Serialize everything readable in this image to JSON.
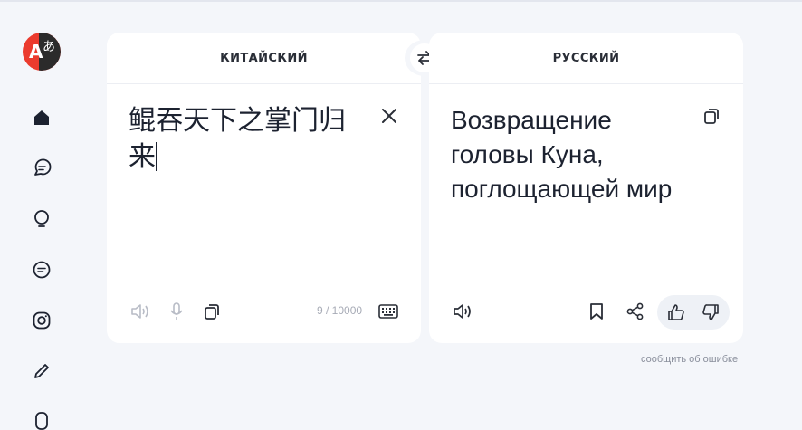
{
  "sidebar": {
    "items": [
      {
        "icon": "home-icon"
      },
      {
        "icon": "chat-icon"
      },
      {
        "icon": "lightbulb-icon"
      },
      {
        "icon": "message-icon"
      },
      {
        "icon": "camera-icon"
      },
      {
        "icon": "pencil-icon"
      },
      {
        "icon": "document-icon"
      }
    ]
  },
  "source": {
    "language": "КИТАЙСКИЙ",
    "text": "鲲吞天下之掌门归来",
    "counter": "9 / 10000"
  },
  "target": {
    "language": "РУССКИЙ",
    "text": "Возвращение головы Куна, поглощающей мир"
  },
  "footer": {
    "report_label": "сообщить об ошибке"
  },
  "colors": {
    "accent_red": "#eb3b2e",
    "text_dark": "#1c2230",
    "background": "#f4f6fa"
  }
}
